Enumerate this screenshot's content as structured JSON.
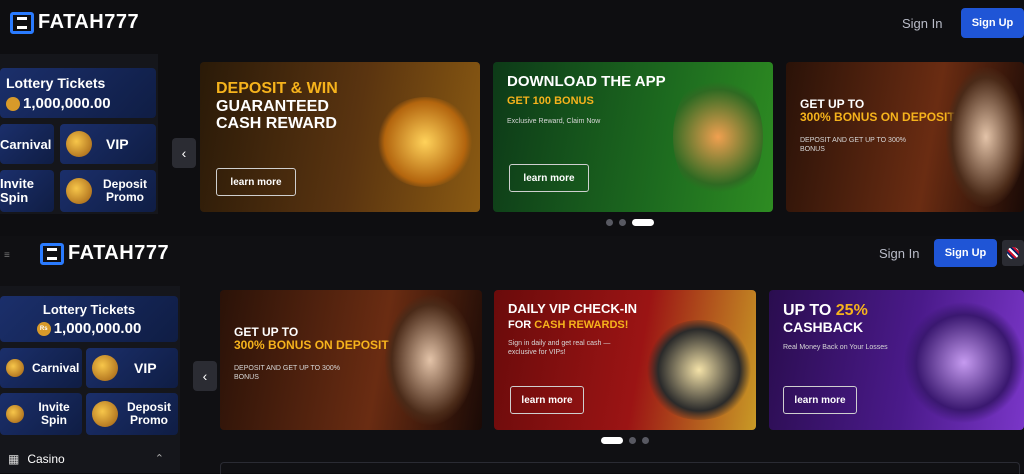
{
  "top": {
    "brand": "FATAH777",
    "signin": "Sign In",
    "signup": "Sign Up",
    "sidebar": {
      "lottery_title": "Lottery Tickets",
      "lottery_amount": "1,000,000.00",
      "items": [
        {
          "label": "Carnival"
        },
        {
          "label": "VIP"
        },
        {
          "label": "Invite Spin"
        },
        {
          "label": "Deposit Promo"
        }
      ]
    },
    "banners": [
      {
        "title_1": "DEPOSIT & WIN",
        "title_2": "GUARANTEED",
        "title_3": "CASH REWARD",
        "button": "learn more"
      },
      {
        "title_1": "DOWNLOAD THE APP",
        "title_2": "GET 100 BONUS",
        "sub": "Exclusive Reward, Claim Now",
        "button": "learn more"
      },
      {
        "title_1": "GET UP TO",
        "title_2": "300% BONUS ON DEPOSIT",
        "sub": "DEPOSIT AND GET UP TO 300% BONUS"
      }
    ]
  },
  "bottom": {
    "brand": "FATAH777",
    "signin": "Sign In",
    "signup": "Sign Up",
    "sidebar": {
      "lottery_title": "Lottery Tickets",
      "lottery_coin": "Rs",
      "lottery_amount": "1,000,000.00",
      "items": [
        {
          "label": "Carnival"
        },
        {
          "label": "VIP"
        },
        {
          "label": "Invite Spin"
        },
        {
          "label": "Deposit Promo"
        }
      ],
      "casino_label": "Casino"
    },
    "banners": [
      {
        "title_1": "GET UP TO",
        "title_2": "300% BONUS ON DEPOSIT",
        "sub": "DEPOSIT AND GET UP TO 300% BONUS"
      },
      {
        "title_1": "DAILY VIP CHECK-IN",
        "title_2a": "FOR ",
        "title_2b": "CASH REWARDS!",
        "sub": "Sign in daily and get real cash — exclusive for VIPs!",
        "button": "learn more"
      },
      {
        "title_1a": "UP TO ",
        "title_1b": "25%",
        "title_2": "CASHBACK",
        "sub": "Real Money Back on Your Losses",
        "button": "learn more"
      }
    ]
  },
  "colors": {
    "accent": "#1f55d6",
    "gold": "#f6b31c",
    "logo": "#2a7bff"
  },
  "icons": [
    "logo-icon",
    "chevron-left-icon",
    "menu-icon",
    "casino-icon",
    "chevron-up-icon",
    "uk-flag-icon"
  ]
}
